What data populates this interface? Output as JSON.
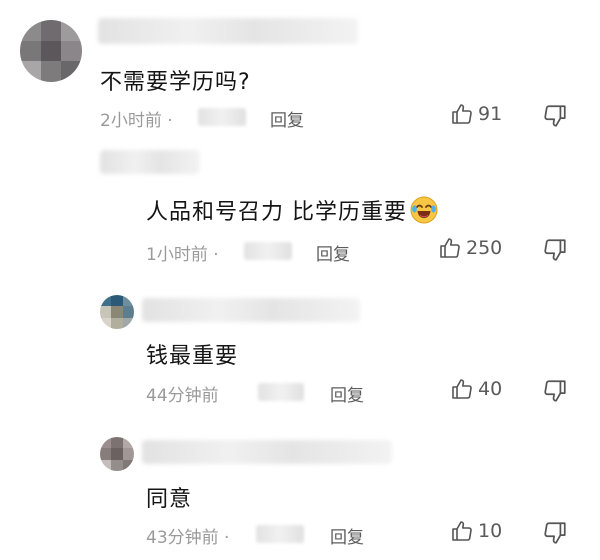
{
  "icons": {
    "like": "thumbs-up-icon",
    "dislike": "thumbs-down-icon",
    "emoji": "crying-laughing-emoji"
  },
  "colors": {
    "text": "#151515",
    "meta": "#9a9a9a",
    "reply": "#5c5c5c",
    "count": "#5a5a5a"
  },
  "comments": [
    {
      "text": "不需要学历吗?",
      "time": "2小时前 ·",
      "reply": "回复",
      "likes": "91"
    },
    {
      "text": "人品和号召力 比学历重要",
      "time": "1小时前 ·",
      "reply": "回复",
      "likes": "250"
    },
    {
      "text": "钱最重要",
      "time": "44分钟前",
      "reply": "回复",
      "likes": "40"
    },
    {
      "text": "同意",
      "time": "43分钟前 ·",
      "reply": "回复",
      "likes": "10"
    }
  ]
}
